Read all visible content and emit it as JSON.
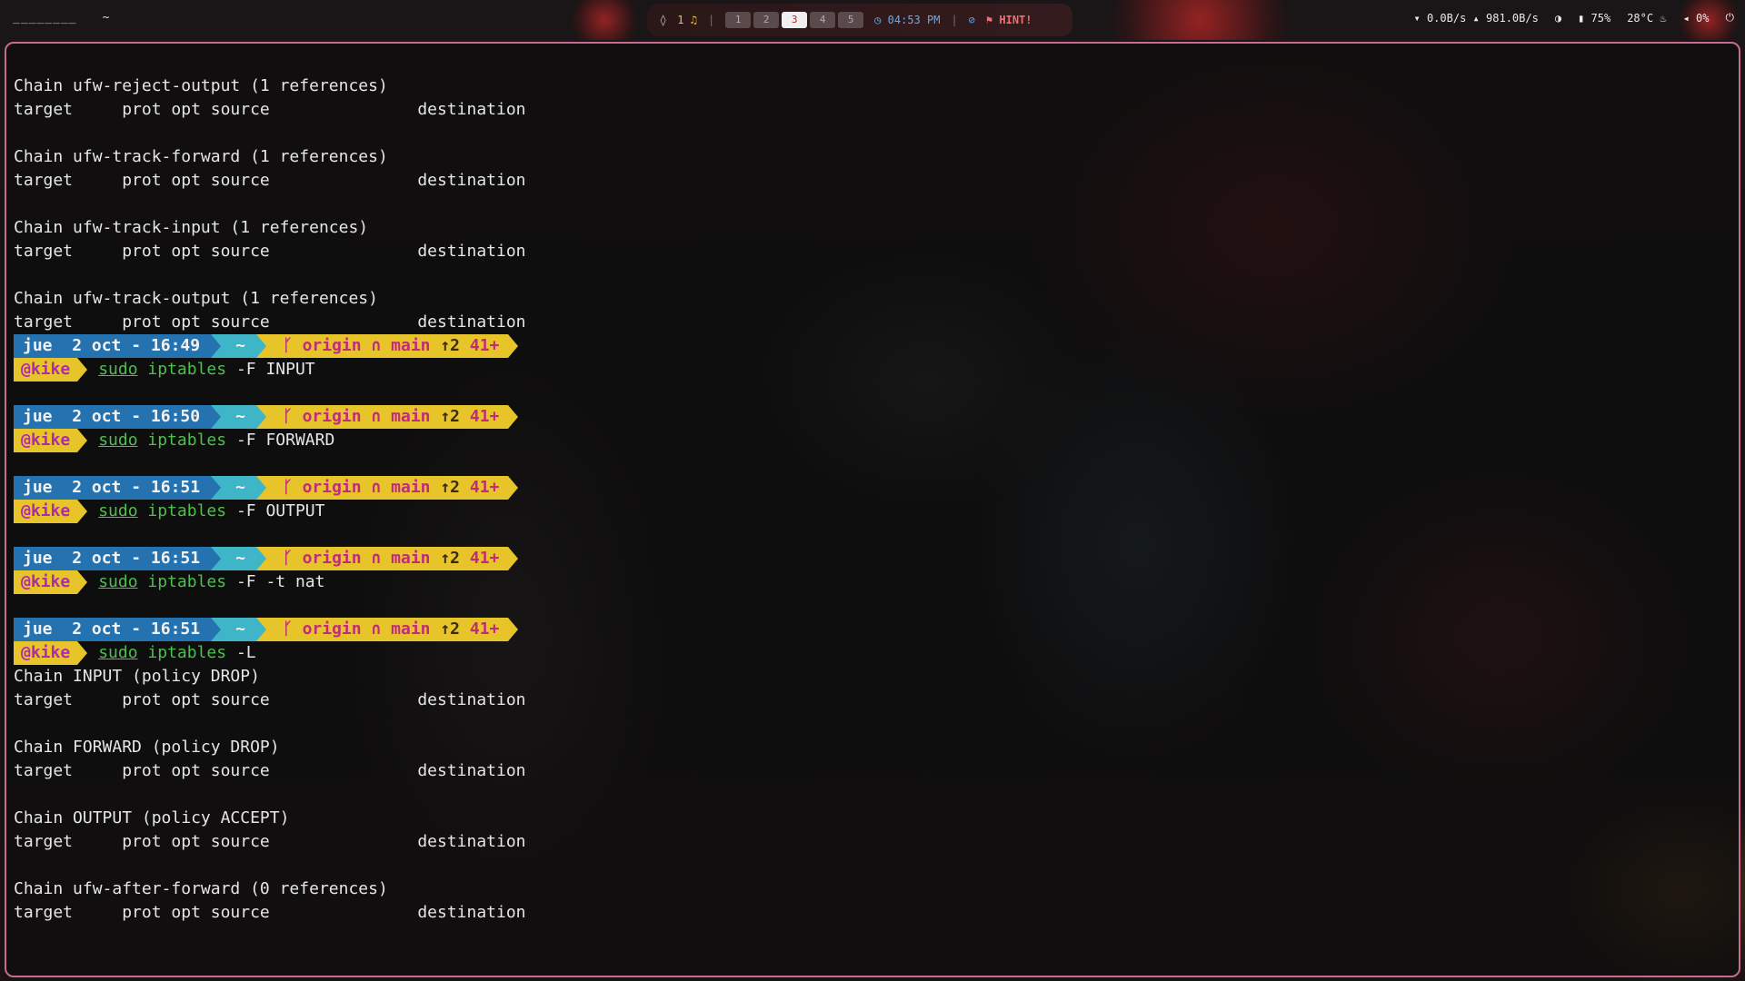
{
  "topbar": {
    "left_title": "________",
    "left_tilde": "~",
    "mic_icon": "water-drop-icon",
    "notification_count": "1",
    "workspaces": [
      "1",
      "2",
      "3",
      "4",
      "5"
    ],
    "active_workspace": "3",
    "clock": "04:53 PM",
    "hint": "HINT!",
    "net_down": "0.0B/s",
    "net_up": "981.0B/s",
    "battery": "75%",
    "temperature": "28°C",
    "volume": "0%"
  },
  "terminal": {
    "top_chains": [
      {
        "title": "Chain ufw-reject-output (1 references)",
        "header": "target     prot opt source               destination"
      },
      {
        "title": "Chain ufw-track-forward (1 references)",
        "header": "target     prot opt source               destination"
      },
      {
        "title": "Chain ufw-track-input (1 references)",
        "header": "target     prot opt source               destination"
      },
      {
        "title": "Chain ufw-track-output (1 references)",
        "header": "target     prot opt source               destination"
      }
    ],
    "prompts": [
      {
        "day": "jue",
        "date": "2 oct - 16:49",
        "dir": "~",
        "remote": "origin",
        "branch": "main",
        "ahead": "↑2",
        "changes": "41+",
        "user": "@kike",
        "sudo": "sudo",
        "bin": "iptables",
        "args": "-F INPUT"
      },
      {
        "day": "jue",
        "date": "2 oct - 16:50",
        "dir": "~",
        "remote": "origin",
        "branch": "main",
        "ahead": "↑2",
        "changes": "41+",
        "user": "@kike",
        "sudo": "sudo",
        "bin": "iptables",
        "args": "-F FORWARD"
      },
      {
        "day": "jue",
        "date": "2 oct - 16:51",
        "dir": "~",
        "remote": "origin",
        "branch": "main",
        "ahead": "↑2",
        "changes": "41+",
        "user": "@kike",
        "sudo": "sudo",
        "bin": "iptables",
        "args": "-F OUTPUT"
      },
      {
        "day": "jue",
        "date": "2 oct - 16:51",
        "dir": "~",
        "remote": "origin",
        "branch": "main",
        "ahead": "↑2",
        "changes": "41+",
        "user": "@kike",
        "sudo": "sudo",
        "bin": "iptables",
        "args": "-F -t nat"
      },
      {
        "day": "jue",
        "date": "2 oct - 16:51",
        "dir": "~",
        "remote": "origin",
        "branch": "main",
        "ahead": "↑2",
        "changes": "41+",
        "user": "@kike",
        "sudo": "sudo",
        "bin": "iptables",
        "args": "-L"
      }
    ],
    "bottom_chains": [
      {
        "title": "Chain INPUT (policy DROP)",
        "header": "target     prot opt source               destination"
      },
      {
        "title": "Chain FORWARD (policy DROP)",
        "header": "target     prot opt source               destination"
      },
      {
        "title": "Chain OUTPUT (policy ACCEPT)",
        "header": "target     prot opt source               destination"
      },
      {
        "title": "Chain ufw-after-forward (0 references)",
        "header": "target     prot opt source               destination"
      }
    ]
  },
  "colors": {
    "border": "#c86b8e",
    "date_segment": "#2572b0",
    "dir_segment": "#3fb6c8",
    "git_segment": "#e7c52a",
    "command": "#4cc04c"
  }
}
